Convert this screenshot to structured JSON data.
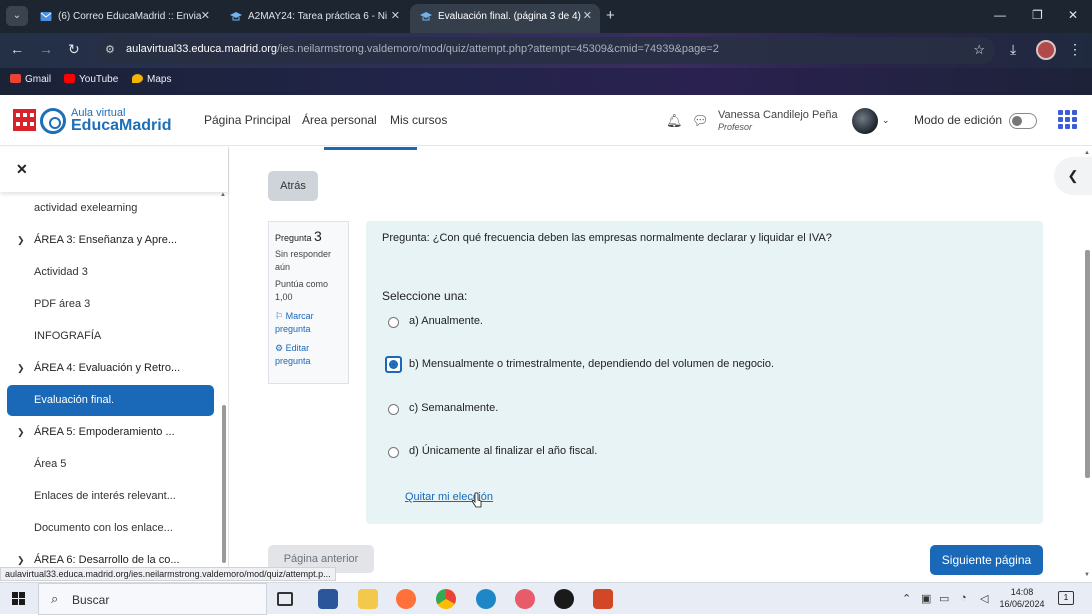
{
  "browser": {
    "tabs": [
      {
        "label": "(6) Correo EducaMadrid :: Envia",
        "active": false
      },
      {
        "label": "A2MAY24: Tarea práctica 6 - Ni",
        "active": false
      },
      {
        "label": "Evaluación final. (página 3 de 4)",
        "active": true
      }
    ],
    "url_host": "aulavirtual33.educa.madrid.org",
    "url_path": "/ies.neilarmstrong.valdemoro/mod/quiz/attempt.php?attempt=45309&cmid=74939&page=2",
    "bookmarks": [
      "Gmail",
      "YouTube",
      "Maps"
    ]
  },
  "site": {
    "logo_top": "Aula virtual",
    "logo_bottom": "EducaMadrid",
    "nav": [
      "Página Principal",
      "Área personal",
      "Mis cursos"
    ],
    "user_name": "Vanessa Candilejo Peña",
    "user_role": "Profesor",
    "edit_mode_label": "Modo de edición"
  },
  "drawer": {
    "items": [
      {
        "label": "actividad exelearning",
        "type": "item"
      },
      {
        "label": "ÁREA 3: Enseñanza y Apre...",
        "type": "section"
      },
      {
        "label": "Actividad 3",
        "type": "item"
      },
      {
        "label": "PDF área 3",
        "type": "item"
      },
      {
        "label": "INFOGRAFÍA",
        "type": "item"
      },
      {
        "label": "ÁREA 4: Evaluación y Retro...",
        "type": "section"
      },
      {
        "label": "Evaluación final.",
        "type": "active"
      },
      {
        "label": "ÁREA 5: Empoderamiento ...",
        "type": "section"
      },
      {
        "label": "Área 5",
        "type": "item"
      },
      {
        "label": "Enlaces de interés relevant...",
        "type": "item"
      },
      {
        "label": "Documento con los enlace...",
        "type": "item"
      },
      {
        "label": "ÁREA 6: Desarrollo de la co...",
        "type": "section"
      }
    ]
  },
  "quiz": {
    "back_label": "Atrás",
    "question_label": "Pregunta",
    "question_number": "3",
    "status": "Sin responder aún",
    "points": "Puntúa como 1,00",
    "flag_label": "Marcar pregunta",
    "edit_label": "Editar pregunta",
    "question_text": "Pregunta: ¿Con qué frecuencia deben las empresas normalmente declarar y liquidar el IVA?",
    "select_prompt": "Seleccione una:",
    "options": [
      {
        "label": "a) Anualmente.",
        "checked": false
      },
      {
        "label": "b) Mensualmente o trimestralmente, dependiendo del volumen de negocio.",
        "checked": true
      },
      {
        "label": "c) Semanalmente.",
        "checked": false
      },
      {
        "label": "d) Únicamente al finalizar el año fiscal.",
        "checked": false
      }
    ],
    "clear_label": "Quitar mi elección",
    "prev_label": "Página anterior",
    "next_label": "Siguiente página"
  },
  "status_url": "aulavirtual33.educa.madrid.org/ies.neilarmstrong.valdemoro/mod/quiz/attempt.p...",
  "taskbar": {
    "search_label": "Buscar",
    "time": "14:08",
    "date": "16/06/2024",
    "notif_count": "1"
  },
  "colors": {
    "accent": "#1a69b8",
    "question_bg": "#e7f3f5"
  }
}
